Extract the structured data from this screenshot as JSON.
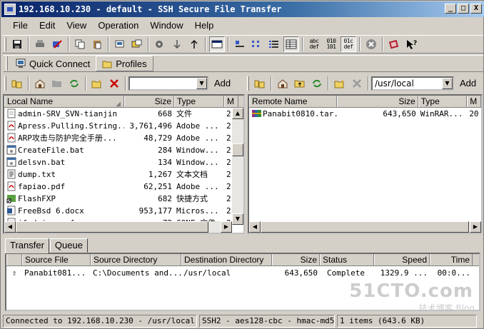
{
  "window": {
    "title": "192.168.10.230 - default - SSH Secure File Transfer",
    "btn_min": "_",
    "btn_max": "□",
    "btn_close": "X"
  },
  "menu": [
    "File",
    "Edit",
    "View",
    "Operation",
    "Window",
    "Help"
  ],
  "toolbar": {
    "abc_label": "abc\ndef",
    "bin_label": "010\n101",
    "auto_label": "01c\ndef"
  },
  "quick": {
    "connect": "Quick Connect",
    "profiles": "Profiles"
  },
  "local_bar": {
    "path": "",
    "add": "Add"
  },
  "remote_bar": {
    "path": "/usr/local",
    "add": "Add"
  },
  "local": {
    "columns": [
      "Local Name",
      "Size",
      "Type",
      "M"
    ],
    "files": [
      {
        "name": "admin-SRV_SVN-tianjin",
        "size": "668",
        "type": "文件",
        "m": "2",
        "icon": "file-icon"
      },
      {
        "name": "Apress.Pulling.String...",
        "size": "3,761,496",
        "type": "Adobe ...",
        "m": "2",
        "icon": "pdf-icon"
      },
      {
        "name": "ARP攻击与防护完全手册...",
        "size": "48,729",
        "type": "Adobe ...",
        "m": "2",
        "icon": "pdf-icon"
      },
      {
        "name": "CreateFile.bat",
        "size": "284",
        "type": "Window...",
        "m": "2",
        "icon": "bat-icon"
      },
      {
        "name": "delsvn.bat",
        "size": "134",
        "type": "Window...",
        "m": "2",
        "icon": "bat-icon"
      },
      {
        "name": "dump.txt",
        "size": "1,267",
        "type": "文本文档",
        "m": "2",
        "icon": "txt-icon"
      },
      {
        "name": "fapiao.pdf",
        "size": "62,251",
        "type": "Adobe ...",
        "m": "2",
        "icon": "pdf-icon"
      },
      {
        "name": "FlashFXP",
        "size": "682",
        "type": "快捷方式",
        "m": "2",
        "icon": "shortcut-icon"
      },
      {
        "name": "FreeBsd 6.docx",
        "size": "953,177",
        "type": "Micros...",
        "m": "2",
        "icon": "doc-icon"
      },
      {
        "name": "ifadmin.conf",
        "size": "72",
        "type": "CONF 文件",
        "m": "2",
        "icon": "file-icon"
      }
    ]
  },
  "remote": {
    "columns": [
      "Remote Name",
      "Size",
      "Type",
      "M"
    ],
    "files": [
      {
        "name": "Panabit0810.tar.tar",
        "size": "643,650",
        "type": "WinRAR...",
        "m": "20",
        "icon": "rar-icon"
      }
    ]
  },
  "tabs": [
    "Transfer",
    "Queue"
  ],
  "transfer": {
    "columns": [
      "Source File",
      "Source Directory",
      "Destination Directory",
      "Size",
      "Status",
      "Speed",
      "Time"
    ],
    "rows": [
      {
        "file": "Panabit081...",
        "src": "C:\\Documents and...",
        "dst": "/usr/local",
        "size": "643,650",
        "status": "Complete",
        "speed": "1329.9 ...",
        "time": "00:0..."
      }
    ]
  },
  "status": {
    "connected": "Connected to 192.168.10.230 - /usr/local",
    "cipher": "SSH2 - aes128-cbc - hmac-md5 - n",
    "items": "1 items (643.6 KB)"
  },
  "watermark": {
    "main": "51CTO.com",
    "sub": "技术博客 Blog"
  }
}
